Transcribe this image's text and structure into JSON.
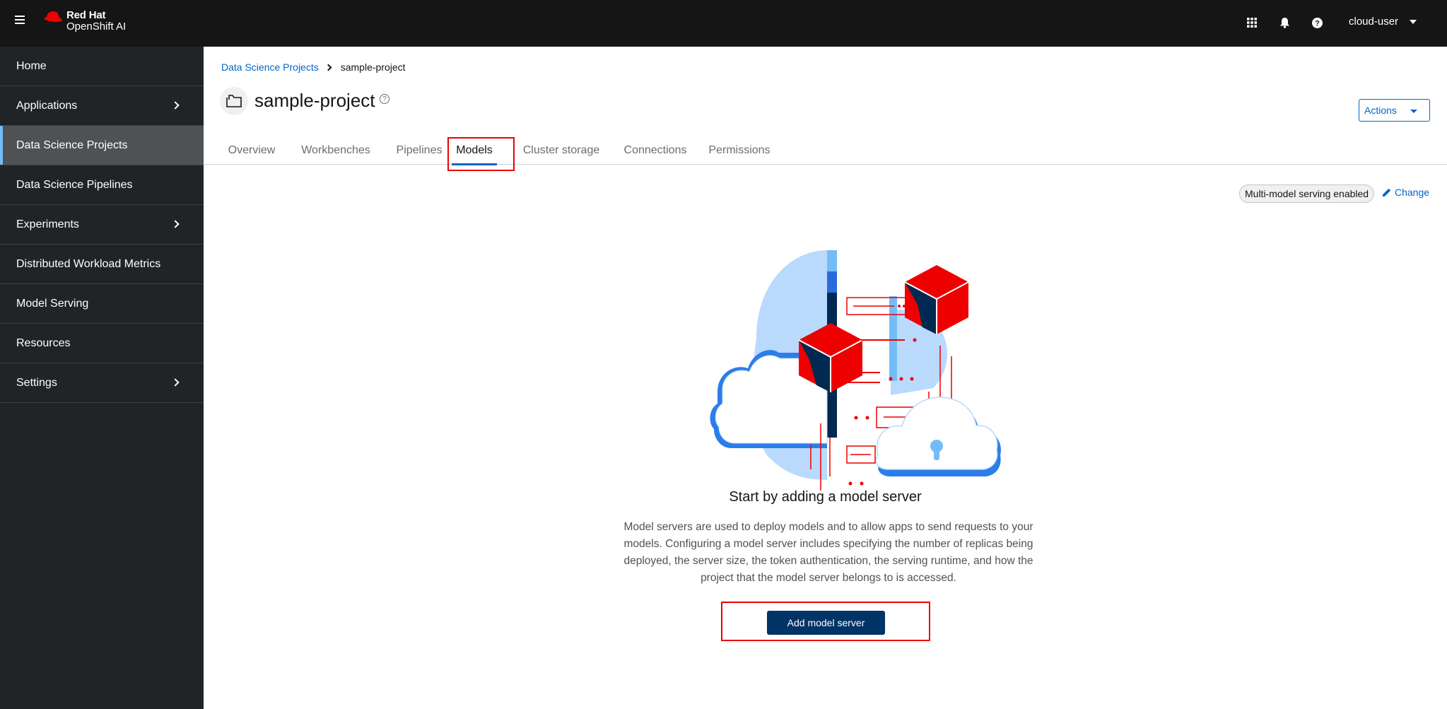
{
  "masthead": {
    "brand_line1": "Red Hat",
    "brand_line2": "OpenShift AI",
    "icons": [
      "apps-grid-icon",
      "bell-icon",
      "help-icon"
    ],
    "user": "cloud-user"
  },
  "sidebar": {
    "items": [
      {
        "label": "Home",
        "expandable": false
      },
      {
        "label": "Applications",
        "expandable": true
      },
      {
        "label": "Data Science Projects",
        "expandable": false,
        "active": true
      },
      {
        "label": "Data Science Pipelines",
        "expandable": false
      },
      {
        "label": "Experiments",
        "expandable": true
      },
      {
        "label": "Distributed Workload Metrics",
        "expandable": false
      },
      {
        "label": "Model Serving",
        "expandable": false
      },
      {
        "label": "Resources",
        "expandable": false
      },
      {
        "label": "Settings",
        "expandable": true
      }
    ]
  },
  "breadcrumb": {
    "parent": "Data Science Projects",
    "current": "sample-project"
  },
  "project": {
    "title": "sample-project",
    "actions_label": "Actions"
  },
  "tabs": [
    {
      "label": "Overview"
    },
    {
      "label": "Workbenches"
    },
    {
      "label": "Pipelines"
    },
    {
      "label": "Models",
      "active": true
    },
    {
      "label": "Cluster storage"
    },
    {
      "label": "Connections"
    },
    {
      "label": "Permissions"
    }
  ],
  "models": {
    "serving_badge": "Multi-model serving enabled",
    "change_label": "Change",
    "empty_title": "Start by adding a model server",
    "empty_body": "Model servers are used to deploy models and to allow apps to send requests to your models. Configuring a model server includes specifying the number of replicas being deployed, the server size, the token authentication, the serving runtime, and how the project that the model server belongs to is accessed.",
    "add_button": "Add model server"
  },
  "colors": {
    "masthead_bg": "#151515",
    "sidebar_bg": "#212427",
    "sidebar_active_bg": "#4f5255",
    "link_blue": "#0066cc",
    "primary_button": "#003366",
    "annotation_red": "#ee0000",
    "brand_red": "#ee0000"
  }
}
